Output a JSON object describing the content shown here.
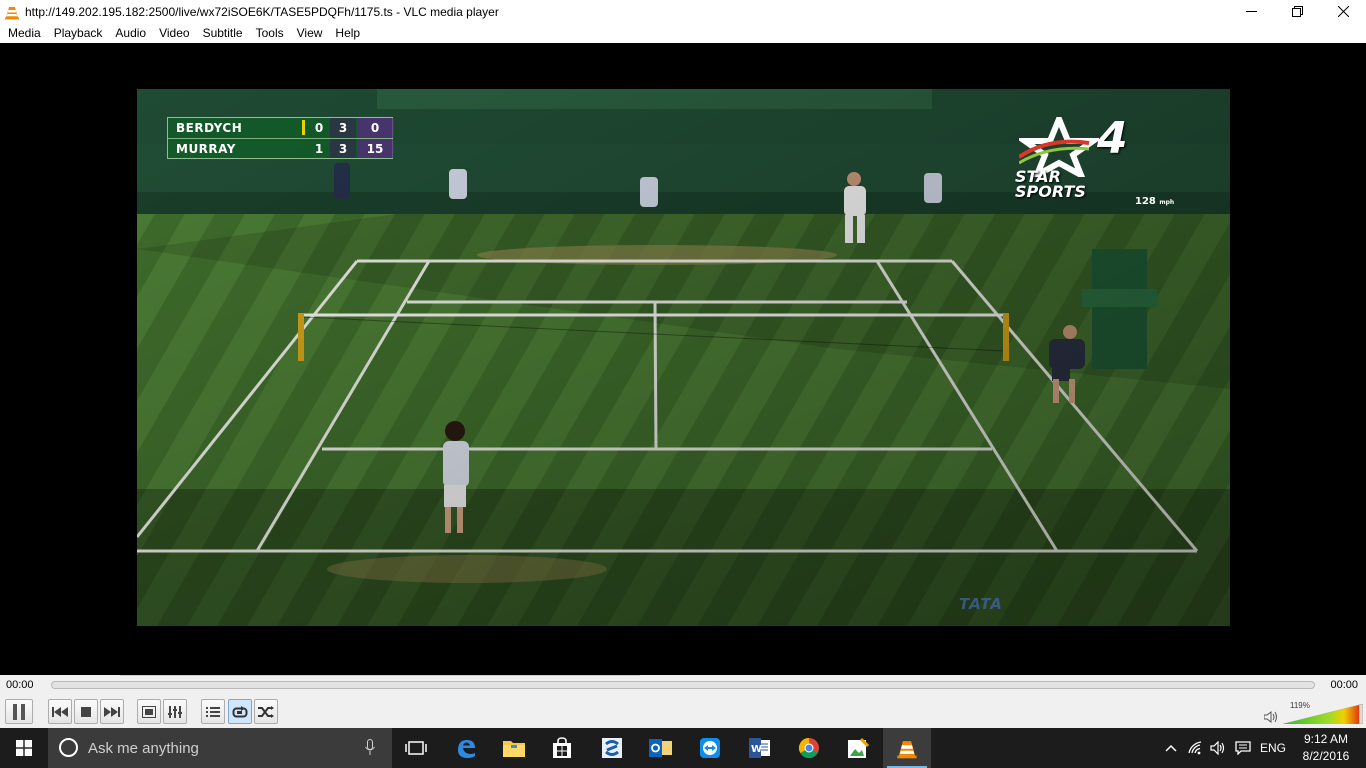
{
  "window": {
    "title": "http://149.202.195.182:2500/live/wx72iSOE6K/TASE5PDQFh/1175.ts - VLC media player"
  },
  "menu": [
    "Media",
    "Playback",
    "Audio",
    "Video",
    "Subtitle",
    "Tools",
    "View",
    "Help"
  ],
  "video": {
    "scoreboard": {
      "rows": [
        {
          "name": "BERDYCH",
          "c1": "0",
          "c2": "3",
          "c3": "0",
          "serving": true
        },
        {
          "name": "MURRAY",
          "c1": "1",
          "c2": "3",
          "c3": "15",
          "serving": false
        }
      ]
    },
    "channel_logo": {
      "line1": "STAR",
      "line2": "SPORTS",
      "number": "4"
    },
    "speed": {
      "value": "128",
      "unit": "mph"
    },
    "watermark": "TATA"
  },
  "player": {
    "elapsed": "00:00",
    "duration": "00:00",
    "progress": 0,
    "volume_label": "119%",
    "volume_level": 1.19
  },
  "taskbar": {
    "search_placeholder": "Ask me anything",
    "language": "ENG",
    "time": "9:12 AM",
    "date": "8/2/2016"
  },
  "colors": {
    "grass": "#3e6b2e",
    "scoreboard_green": "#125a28",
    "taskbar": "#1c1c1c",
    "vlc_orange": "#f08a00"
  }
}
